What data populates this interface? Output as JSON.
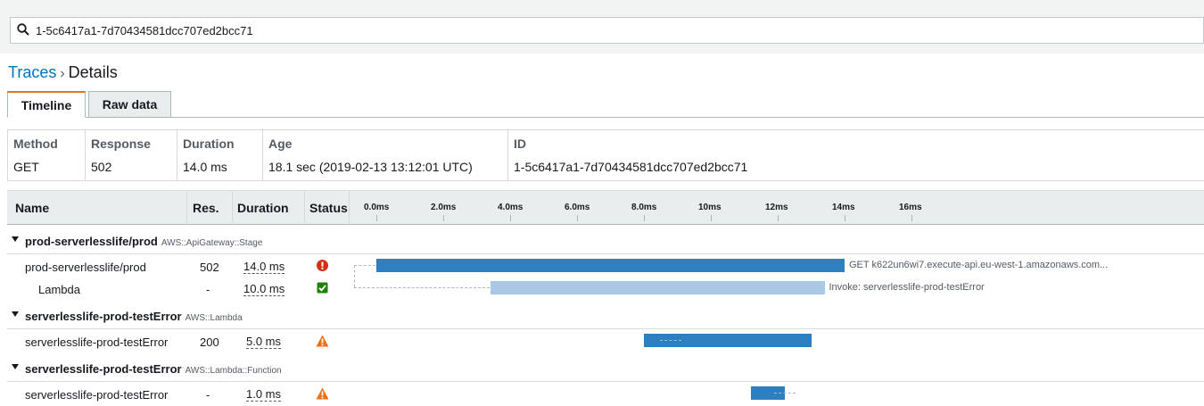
{
  "search": {
    "value": "1-5c6417a1-7d70434581dcc707ed2bcc71"
  },
  "breadcrumb": {
    "root": "Traces",
    "separator": "›",
    "current": "Details"
  },
  "tabs": [
    {
      "label": "Timeline",
      "active": true
    },
    {
      "label": "Raw data",
      "active": false
    }
  ],
  "summary": [
    {
      "header": "Method",
      "value": "GET"
    },
    {
      "header": "Response",
      "value": "502"
    },
    {
      "header": "Duration",
      "value": "14.0 ms"
    },
    {
      "header": "Age",
      "value": "18.1 sec (2019-02-13 13:12:01 UTC)"
    },
    {
      "header": "ID",
      "value": "1-5c6417a1-7d70434581dcc707ed2bcc71"
    }
  ],
  "table": {
    "headers": {
      "name": "Name",
      "res": "Res.",
      "duration": "Duration",
      "status": "Status"
    },
    "ticks": [
      "0.0ms",
      "2.0ms",
      "4.0ms",
      "6.0ms",
      "8.0ms",
      "10ms",
      "12ms",
      "14ms",
      "16ms"
    ]
  },
  "groups": [
    {
      "name": "prod-serverlesslife/prod",
      "type": "AWS::ApiGateway::Stage"
    },
    {
      "name": "serverlesslife-prod-testError",
      "type": "AWS::Lambda"
    },
    {
      "name": "serverlesslife-prod-testError",
      "type": "AWS::Lambda::Function"
    }
  ],
  "rows": [
    {
      "name": "prod-serverlesslife/prod",
      "res": "502",
      "duration": "14.0 ms",
      "status": "error",
      "start_ms": 0.0,
      "duration_ms": 14.0,
      "label": "GET k622un6wi7.execute-api.eu-west-1.amazonaws.com..."
    },
    {
      "name": "Lambda",
      "res": "-",
      "duration": "10.0 ms",
      "status": "ok",
      "start_ms": 3.4,
      "duration_ms": 10.0,
      "label": "Invoke: serverlesslife-prod-testError"
    },
    {
      "name": "serverlesslife-prod-testError",
      "res": "200",
      "duration": "5.0 ms",
      "status": "fault",
      "start_ms": 8.0,
      "duration_ms": 5.0,
      "label": ""
    },
    {
      "name": "serverlesslife-prod-testError",
      "res": "-",
      "duration": "1.0 ms",
      "status": "fault",
      "start_ms": 11.2,
      "duration_ms": 1.0,
      "label": ""
    }
  ],
  "colors": {
    "accent": "#ec7211",
    "link": "#0073bb",
    "bar_primary": "#2e7fbf",
    "bar_secondary": "#a8c8e6",
    "error": "#d13212",
    "ok": "#1d8102",
    "fault": "#ec7211"
  }
}
